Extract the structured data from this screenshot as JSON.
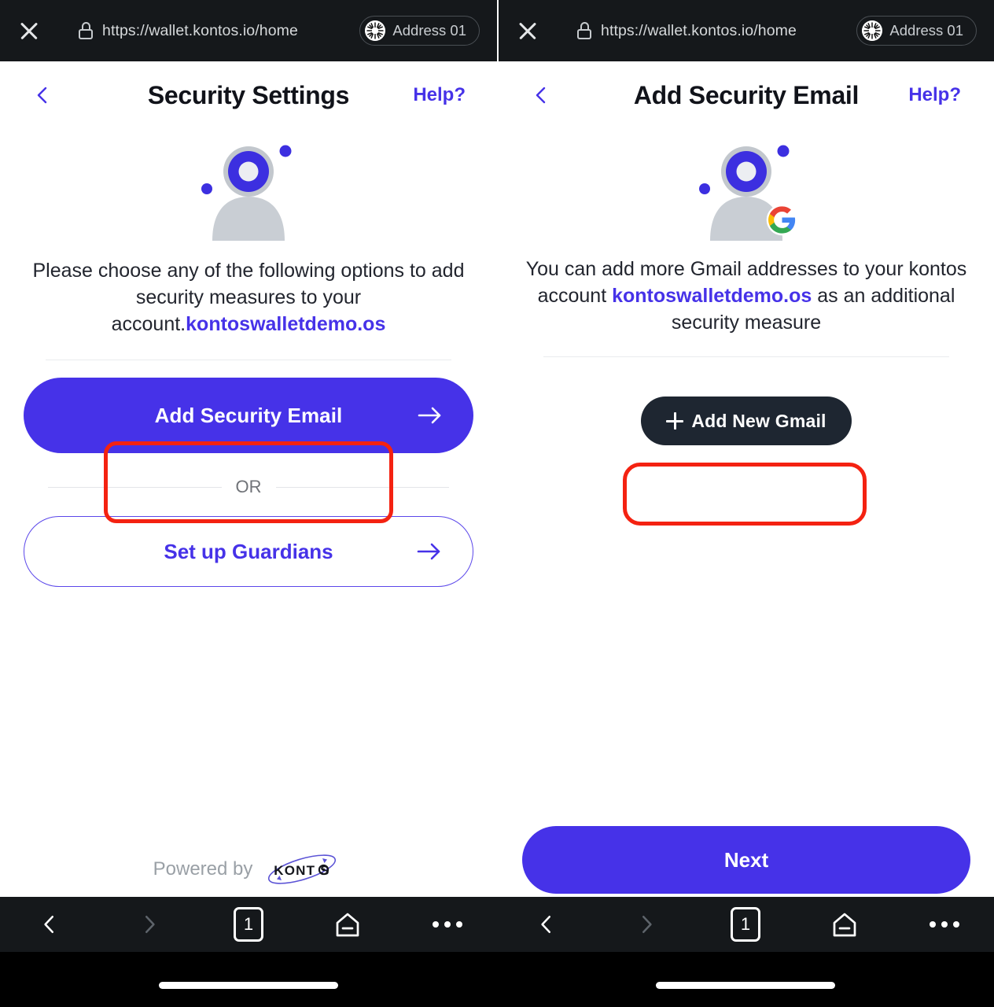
{
  "browser": {
    "tabs": [
      {
        "close_label": "×",
        "url": "https://wallet.kontos.io/home",
        "account_chip": "Address 01"
      },
      {
        "close_label": "×",
        "url": "https://wallet.kontos.io/home",
        "account_chip": "Address 01"
      }
    ],
    "bottom_nav": {
      "back": "back-arrow",
      "forward": "forward-arrow",
      "tab_count": "1",
      "home": "home-icon",
      "more": "more-options"
    }
  },
  "panes": [
    {
      "title": "Security Settings",
      "help_label": "Help?",
      "avatar_icon": "user-avatar-icon",
      "description_prefix": "Please choose any of the following options to add security measures to your account.",
      "description_highlight": "kontoswalletdemo.os",
      "description_suffix": "",
      "primary_button": "Add Security Email",
      "or_label": "OR",
      "secondary_button": "Set up Guardians",
      "footer_text": "Powered by",
      "footer_brand": "KONTOS"
    },
    {
      "title": "Add Security Email",
      "help_label": "Help?",
      "avatar_icon": "user-avatar-google-icon",
      "description_prefix": "You can add more Gmail addresses to your kontos account ",
      "description_highlight": "kontoswalletdemo.os",
      "description_suffix": " as an additional security measure",
      "add_gmail_button": "Add New Gmail",
      "next_button": "Next"
    }
  ],
  "annotations": {
    "highlight_color": "#f42211",
    "highlighted_elements": [
      "Add Security Email",
      "Add New Gmail"
    ]
  },
  "colors": {
    "brand_blue": "#4632e8",
    "dark_button": "#1e2631",
    "chrome_bg": "#15181b",
    "highlight_red": "#f42211"
  }
}
